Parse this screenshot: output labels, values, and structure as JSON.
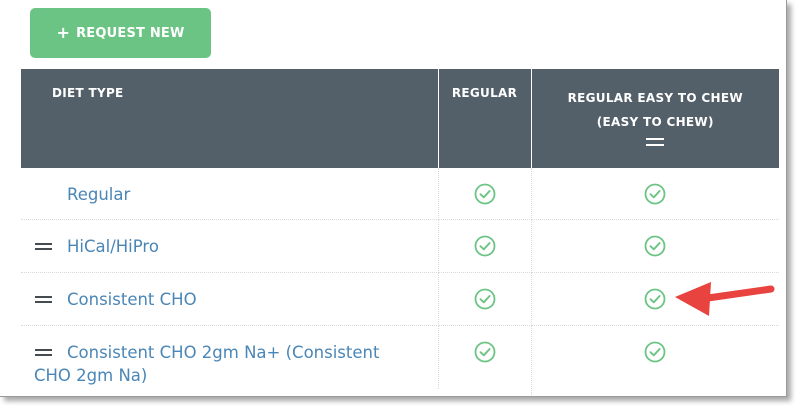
{
  "toolbar": {
    "request_new_label": "REQUEST NEW",
    "plus_icon": "+"
  },
  "table": {
    "headers": {
      "diet_type": "DIET TYPE",
      "regular": "REGULAR",
      "easy_to_chew": "REGULAR EASY TO CHEW (EASY TO CHEW)"
    },
    "rows": [
      {
        "name": "Regular",
        "draggable": false,
        "regular": true,
        "easy_to_chew": true
      },
      {
        "name": "HiCal/HiPro",
        "draggable": true,
        "regular": true,
        "easy_to_chew": true
      },
      {
        "name": "Consistent CHO",
        "draggable": true,
        "regular": true,
        "easy_to_chew": true
      },
      {
        "name": "Consistent CHO 2gm Na+ (Consistent CHO 2gm Na)",
        "draggable": true,
        "regular": true,
        "easy_to_chew": true
      }
    ]
  },
  "colors": {
    "button_green": "#6cc484",
    "header_bg": "#546069",
    "link_blue": "#4a86b6",
    "check_green": "#6cc484",
    "arrow_red": "#e8433f"
  },
  "icons": {
    "check": "check-circle-icon",
    "drag": "drag-handle-icon",
    "annotation": "red-arrow-icon"
  }
}
